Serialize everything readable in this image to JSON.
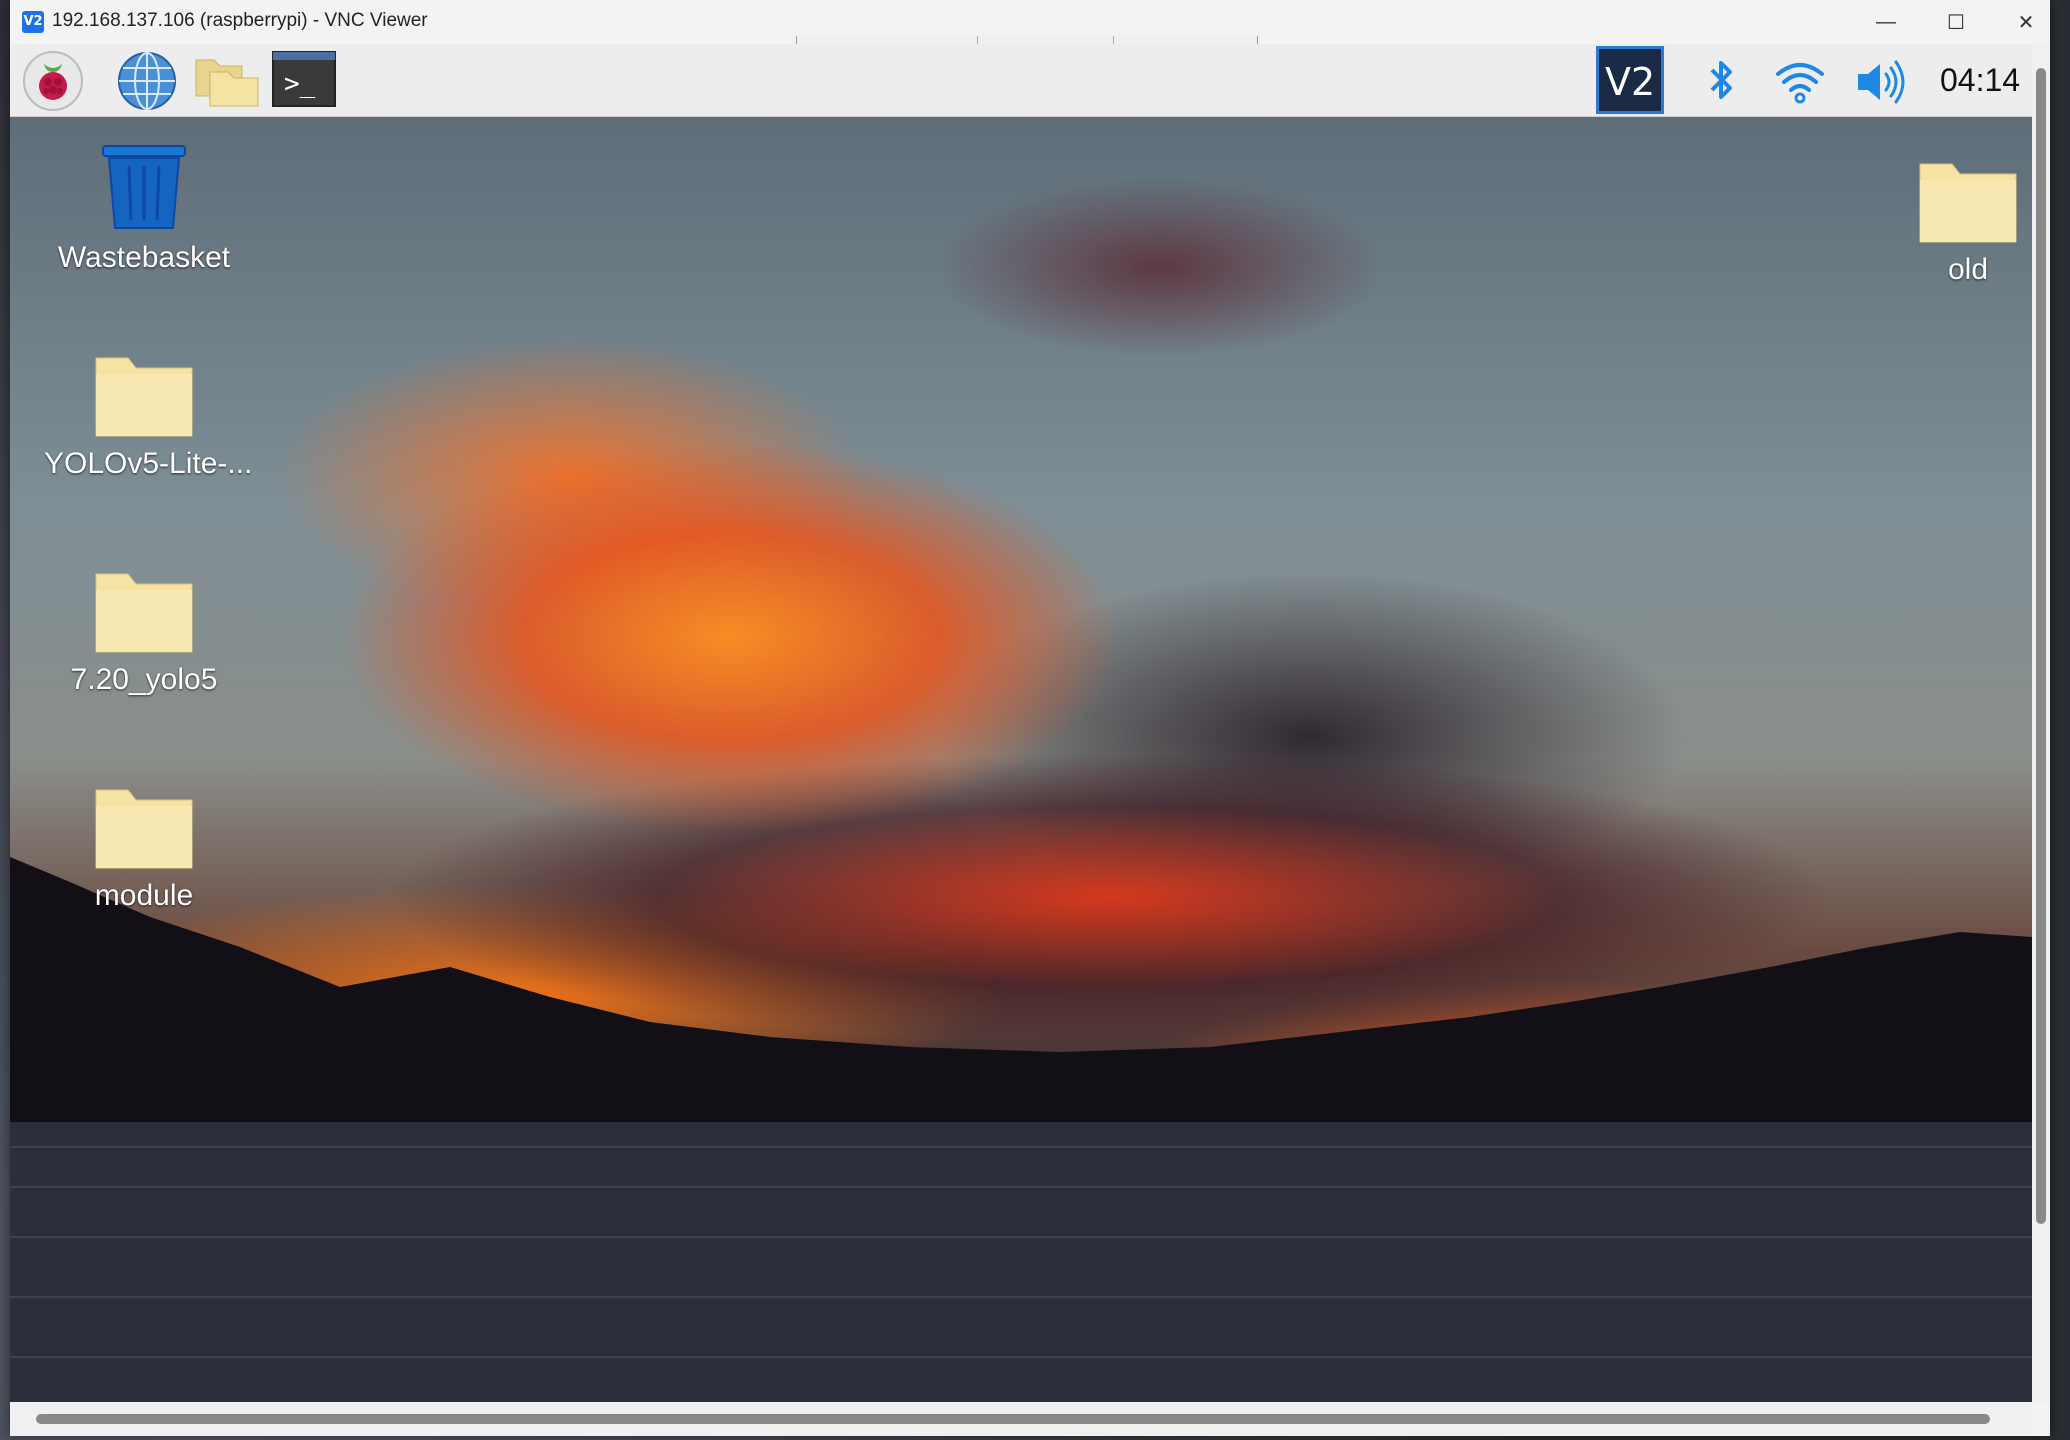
{
  "window": {
    "title": "192.168.137.106 (raspberrypi) - VNC Viewer",
    "app_icon_text": "V2",
    "controls": {
      "minimize": "—",
      "maximize": "☐",
      "close": "✕"
    }
  },
  "panel": {
    "launchers": [
      {
        "name": "raspberry-menu",
        "icon": "raspberry-icon"
      },
      {
        "name": "web-browser",
        "icon": "globe-icon"
      },
      {
        "name": "file-manager",
        "icon": "folder-icon"
      },
      {
        "name": "terminal",
        "icon": "terminal-icon",
        "text": ">_"
      }
    ],
    "tray": {
      "vnc_text": "V2",
      "bluetooth": "bluetooth-icon",
      "wifi": "wifi-icon",
      "volume": "volume-icon"
    },
    "clock": "04:14"
  },
  "desktop": {
    "icons": [
      {
        "label": "Wastebasket",
        "icon": "trash-icon"
      },
      {
        "label": "YOLOv5-Lite-...",
        "icon": "folder-icon"
      },
      {
        "label": "7.20_yolo5",
        "icon": "folder-icon"
      },
      {
        "label": "module",
        "icon": "folder-icon"
      },
      {
        "label": "old",
        "icon": "folder-icon"
      }
    ]
  },
  "colors": {
    "accent": "#2a7bd8",
    "folder": "#f5e3a3",
    "trash": "#1565c0",
    "tray_icon": "#1e88e5"
  }
}
